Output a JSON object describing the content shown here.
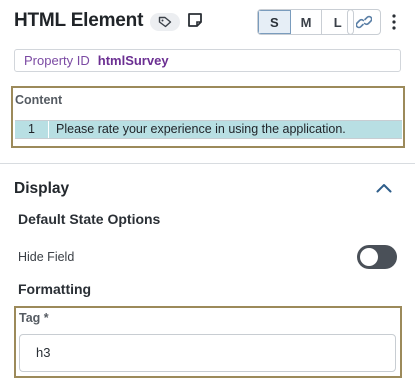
{
  "header": {
    "title": "HTML Element",
    "sizes": [
      "S",
      "M",
      "L"
    ],
    "active_size": "S"
  },
  "property": {
    "label": "Property ID",
    "value": "htmlSurvey"
  },
  "content": {
    "title": "Content",
    "rows": [
      {
        "num": "1",
        "text": "Please rate your experience in using the application."
      }
    ]
  },
  "display": {
    "title": "Display",
    "default_state_title": "Default State Options",
    "hide_field_label": "Hide Field",
    "hide_field_on": false,
    "formatting_title": "Formatting",
    "tag_label": "Tag *",
    "tag_value": "h3"
  },
  "colors": {
    "accent": "#7b4aa3",
    "highlight_row": "#b8dfe3",
    "focus_border": "#9c8a5a",
    "toggle_off": "#4a5058"
  },
  "icons": {
    "tag": "tag-icon",
    "note": "note-icon",
    "link": "link-icon",
    "more": "kebab-menu-icon",
    "collapse": "chevron-up-icon"
  }
}
